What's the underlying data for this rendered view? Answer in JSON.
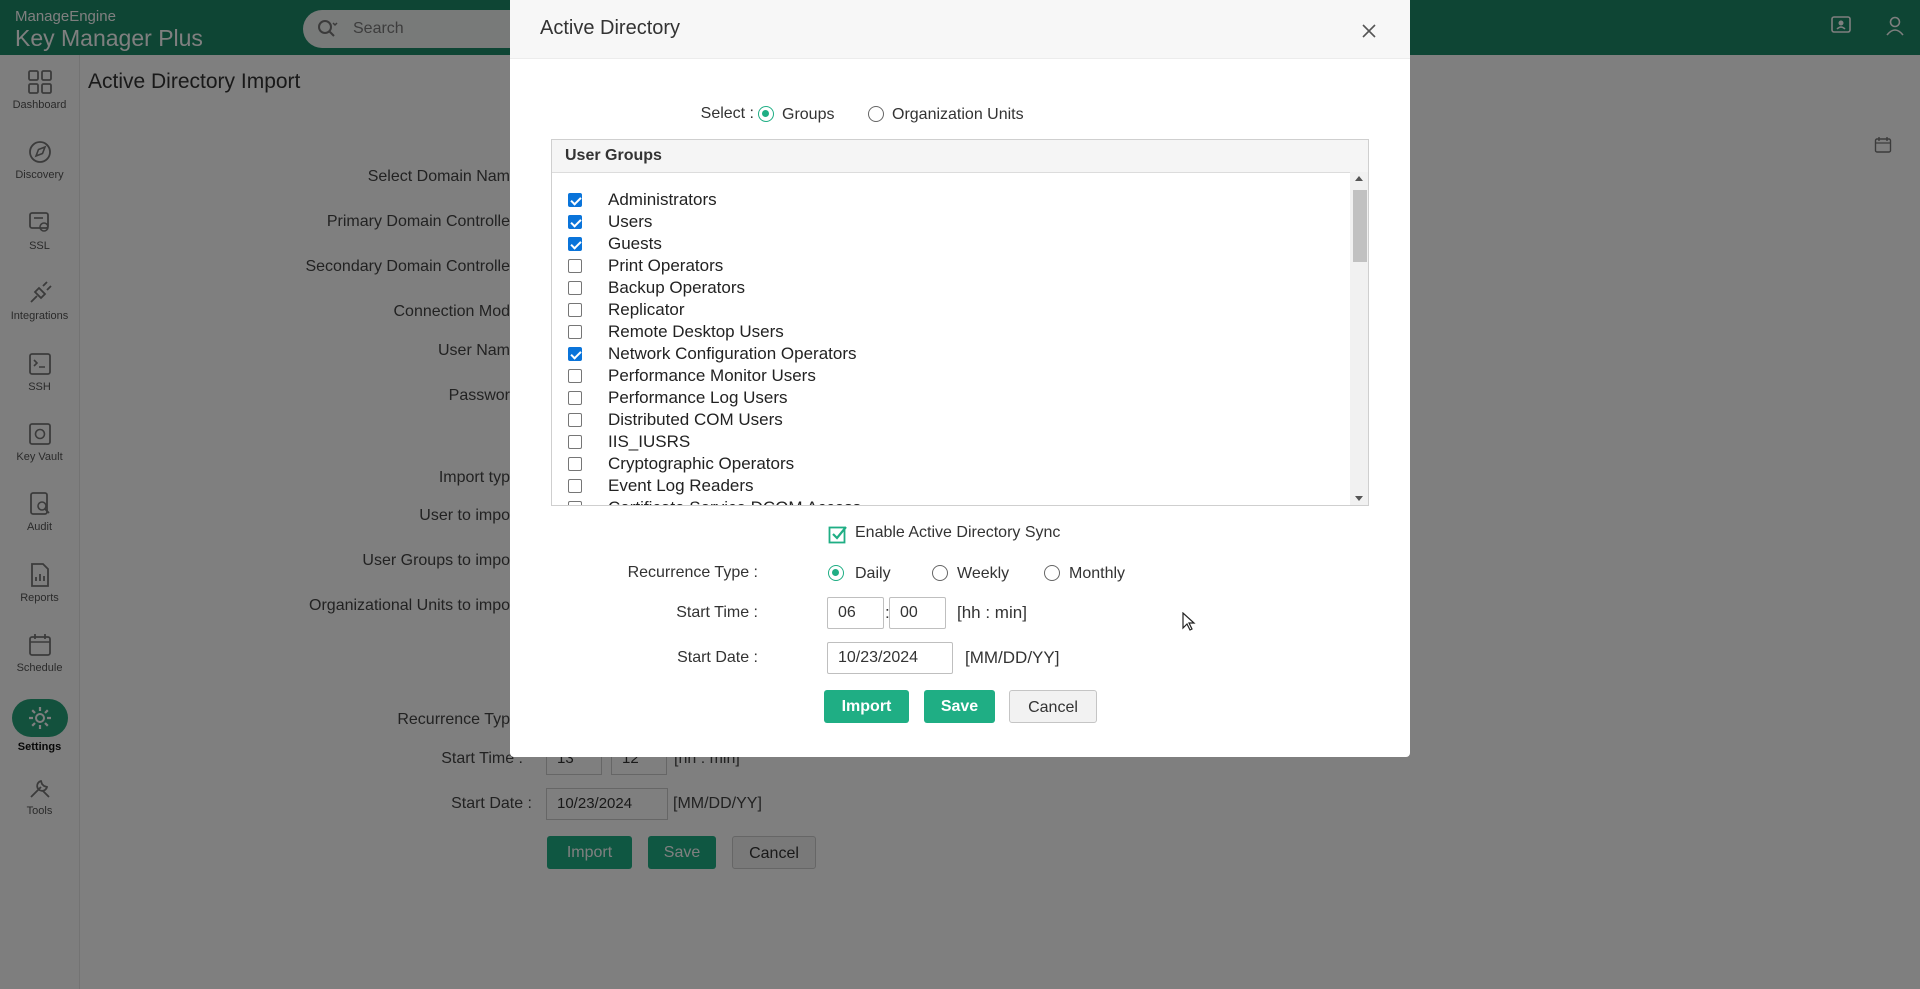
{
  "app": {
    "brand_top": "ManageEngine",
    "brand_name": "Key Manager Plus",
    "search_placeholder": "Search",
    "page_title": "Active Directory Import"
  },
  "sidebar": {
    "items": [
      {
        "label": "Dashboard",
        "icon": "dashboard-icon"
      },
      {
        "label": "Discovery",
        "icon": "discovery-icon"
      },
      {
        "label": "SSL",
        "icon": "ssl-icon"
      },
      {
        "label": "Integrations",
        "icon": "integrations-icon"
      },
      {
        "label": "SSH",
        "icon": "ssh-icon"
      },
      {
        "label": "Key Vault",
        "icon": "key-vault-icon"
      },
      {
        "label": "Audit",
        "icon": "audit-icon"
      },
      {
        "label": "Reports",
        "icon": "reports-icon"
      },
      {
        "label": "Schedule",
        "icon": "schedule-icon"
      },
      {
        "label": "Settings",
        "icon": "settings-icon",
        "active": true
      },
      {
        "label": "Tools",
        "icon": "tools-icon"
      }
    ]
  },
  "background_form": {
    "labels": [
      "Select Domain Nam",
      "Primary Domain Controlle",
      "Secondary Domain Controlle",
      "Connection Mod",
      "User Nam",
      "Passwor",
      "Import typ",
      "User to impo",
      "User Groups to impo",
      "Organizational Units to impo",
      "Recurrence Typ"
    ],
    "start_time_label": "Start Time :",
    "start_hour": "13",
    "start_min": "12",
    "time_unit": "[hh : min]",
    "start_date_label": "Start Date :",
    "start_date": "10/23/2024",
    "date_unit": "[MM/DD/YY]",
    "import_label": "Import",
    "save_label": "Save",
    "cancel_label": "Cancel"
  },
  "modal": {
    "title": "Active Directory",
    "select_label": "Select :",
    "options": [
      {
        "label": "Groups",
        "selected": true
      },
      {
        "label": "Organization Units",
        "selected": false
      }
    ],
    "groups_header": "User Groups",
    "groups": [
      {
        "name": "Administrators",
        "checked": true
      },
      {
        "name": "Users",
        "checked": true
      },
      {
        "name": "Guests",
        "checked": true
      },
      {
        "name": "Print Operators",
        "checked": false
      },
      {
        "name": "Backup Operators",
        "checked": false
      },
      {
        "name": "Replicator",
        "checked": false
      },
      {
        "name": "Remote Desktop Users",
        "checked": false
      },
      {
        "name": "Network Configuration Operators",
        "checked": true
      },
      {
        "name": "Performance Monitor Users",
        "checked": false
      },
      {
        "name": "Performance Log Users",
        "checked": false
      },
      {
        "name": "Distributed COM Users",
        "checked": false
      },
      {
        "name": "IIS_IUSRS",
        "checked": false
      },
      {
        "name": "Cryptographic Operators",
        "checked": false
      },
      {
        "name": "Event Log Readers",
        "checked": false
      },
      {
        "name": "Certificate Service DCOM Access",
        "checked": false
      }
    ],
    "sync_label": "Enable Active Directory Sync",
    "sync_checked": true,
    "recurrence_label": "Recurrence Type :",
    "recurrence_options": [
      {
        "label": "Daily",
        "selected": true
      },
      {
        "label": "Weekly",
        "selected": false
      },
      {
        "label": "Monthly",
        "selected": false
      }
    ],
    "start_time_label": "Start Time :",
    "start_hour": "06",
    "start_min": "00",
    "time_sep": ":",
    "time_unit": "[hh : min]",
    "start_date_label": "Start Date :",
    "start_date": "10/23/2024",
    "date_unit": "[MM/DD/YY]",
    "import_label": "Import",
    "save_label": "Save",
    "cancel_label": "Cancel",
    "colors": {
      "accent": "#1fae84",
      "check": "#0a74da"
    }
  }
}
